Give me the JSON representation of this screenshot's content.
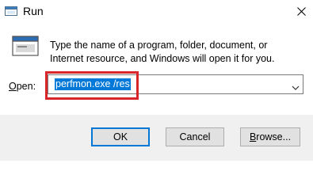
{
  "window": {
    "title": "Run"
  },
  "icons": {
    "title_icon": "run-icon",
    "dialog_icon": "run-icon",
    "close_icon": "close-icon",
    "dropdown_icon": "chevron-down-icon"
  },
  "dialog": {
    "description": "Type the name of a program, folder, document, or Internet resource, and Windows will open it for you.",
    "open_label_mnemonic": "O",
    "open_label_rest": "pen:",
    "open_value": "perfmon.exe /res"
  },
  "buttons": {
    "ok_label": "OK",
    "cancel_label": "Cancel",
    "browse_mnemonic": "B",
    "browse_rest": "rowse..."
  },
  "colors": {
    "selection": "#0078d7",
    "highlight_box": "#d9262b",
    "footer_bg": "#f0f0f0"
  }
}
